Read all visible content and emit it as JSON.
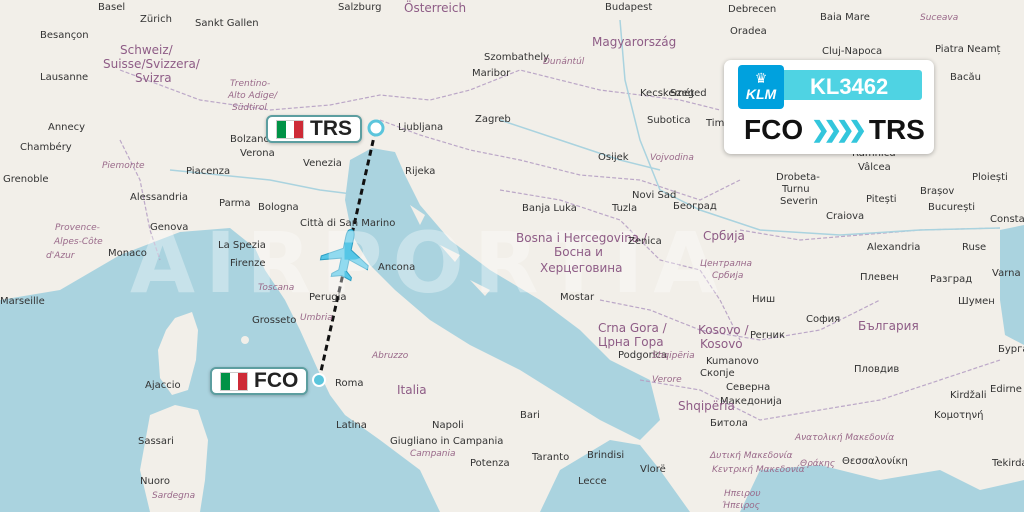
{
  "watermark": "AIRPORTIA",
  "flight_card": {
    "airline_logo_text": "KLM",
    "flight_number": "KL3462",
    "origin": "FCO",
    "destination": "TRS",
    "chevrons": "❯❯❯❯",
    "accent_color": "#4fd3e3",
    "airline_color": "#00a1de"
  },
  "airport_tags": {
    "origin": {
      "code": "FCO",
      "flag": "italy"
    },
    "destination": {
      "code": "TRS",
      "flag": "italy"
    }
  },
  "map_labels": {
    "cities": [
      "Basel",
      "Zürich",
      "Sankt Gallen",
      "Salzburg",
      "Österreich",
      "Budapest",
      "Debrecen",
      "Baia Mare",
      "Suceava",
      "Besançon",
      "Schweiz/",
      "Suisse/Svizzera/",
      "Svizra",
      "Szombathely",
      "Magyarország",
      "Oradea",
      "Piatra Neamț",
      "Lausanne",
      "Trentino-",
      "Alto Adige/",
      "Südtirol",
      "Maribor",
      "Dunántúl",
      "Kecskemét",
      "Cluj-Napoca",
      "Bacău",
      "Annecy",
      "Bolzano",
      "Ljubljana",
      "Zagreb",
      "Szeged",
      "Timișoara",
      "Chambéry",
      "Venezia",
      "Subotica",
      "Piemonte",
      "Verona",
      "Osijek",
      "Vojvodina",
      "Grenoble",
      "Piacenza",
      "Rijeka",
      "Drobeta-",
      "Turnu",
      "Severin",
      "Râmnicu",
      "Vâlcea",
      "Ploiești",
      "Alessandria",
      "Parma",
      "Bologna",
      "Novi Sad",
      "Brașov",
      "Pitești",
      "București",
      "Genova",
      "Città di San Marino",
      "Banja Luka",
      "Tuzla",
      "Београд",
      "Craiova",
      "Constanța",
      "La Spezia",
      "Ancona",
      "Provence-",
      "Alpes-Côte",
      "d'Azur",
      "Monaco",
      "Firenze",
      "Bosna i Hercegovina /",
      "Босна и",
      "Херцеговина",
      "Србија",
      "Alexandria",
      "Ruse",
      "Varna",
      "Toscana",
      "Централна",
      "Србија",
      "Разград",
      "Perugia",
      "Zenica",
      "Шумен",
      "Marseille",
      "Mostar",
      "Ниш",
      "Плевен",
      "Grosseto",
      "Umbria",
      "Crna Gora /",
      "Црна Гора",
      "Kosovo /",
      "Kosovo",
      "София",
      "България",
      "Бургас",
      "Perник",
      "Roma",
      "Abruzzo",
      "Podgorica",
      "Shqipëria",
      "Verore",
      "Kumanovo",
      "Ajaccio",
      "Italia",
      "Скопје",
      "Северна",
      "Македонија",
      "Пловдив",
      "Latina",
      "Napoli",
      "Giugliano in Campania",
      "Bari",
      "Shqipëria",
      "Kirdžali",
      "Edirne",
      "Sassari",
      "Campania",
      "Taranto",
      "Brindisi",
      "Битола",
      "Ανατολική Μακεδονία",
      "Κομοτηνή",
      "Potenza",
      "Sardegna",
      "Lecce",
      "Vlorë",
      "Θεσσαλονίκη",
      "Tekirdağ",
      "Nuoro",
      "Δυτική Μακεδονία",
      "Κεντρική Μακεδονία",
      "Θράκης",
      "Ηπειρου",
      "Ήπειρος"
    ]
  },
  "colors": {
    "sea": "#aad3df",
    "land": "#f2efe9",
    "route": "#111111",
    "tag_border": "#5c9ea0",
    "airport_dot": "#5bc5dc"
  }
}
